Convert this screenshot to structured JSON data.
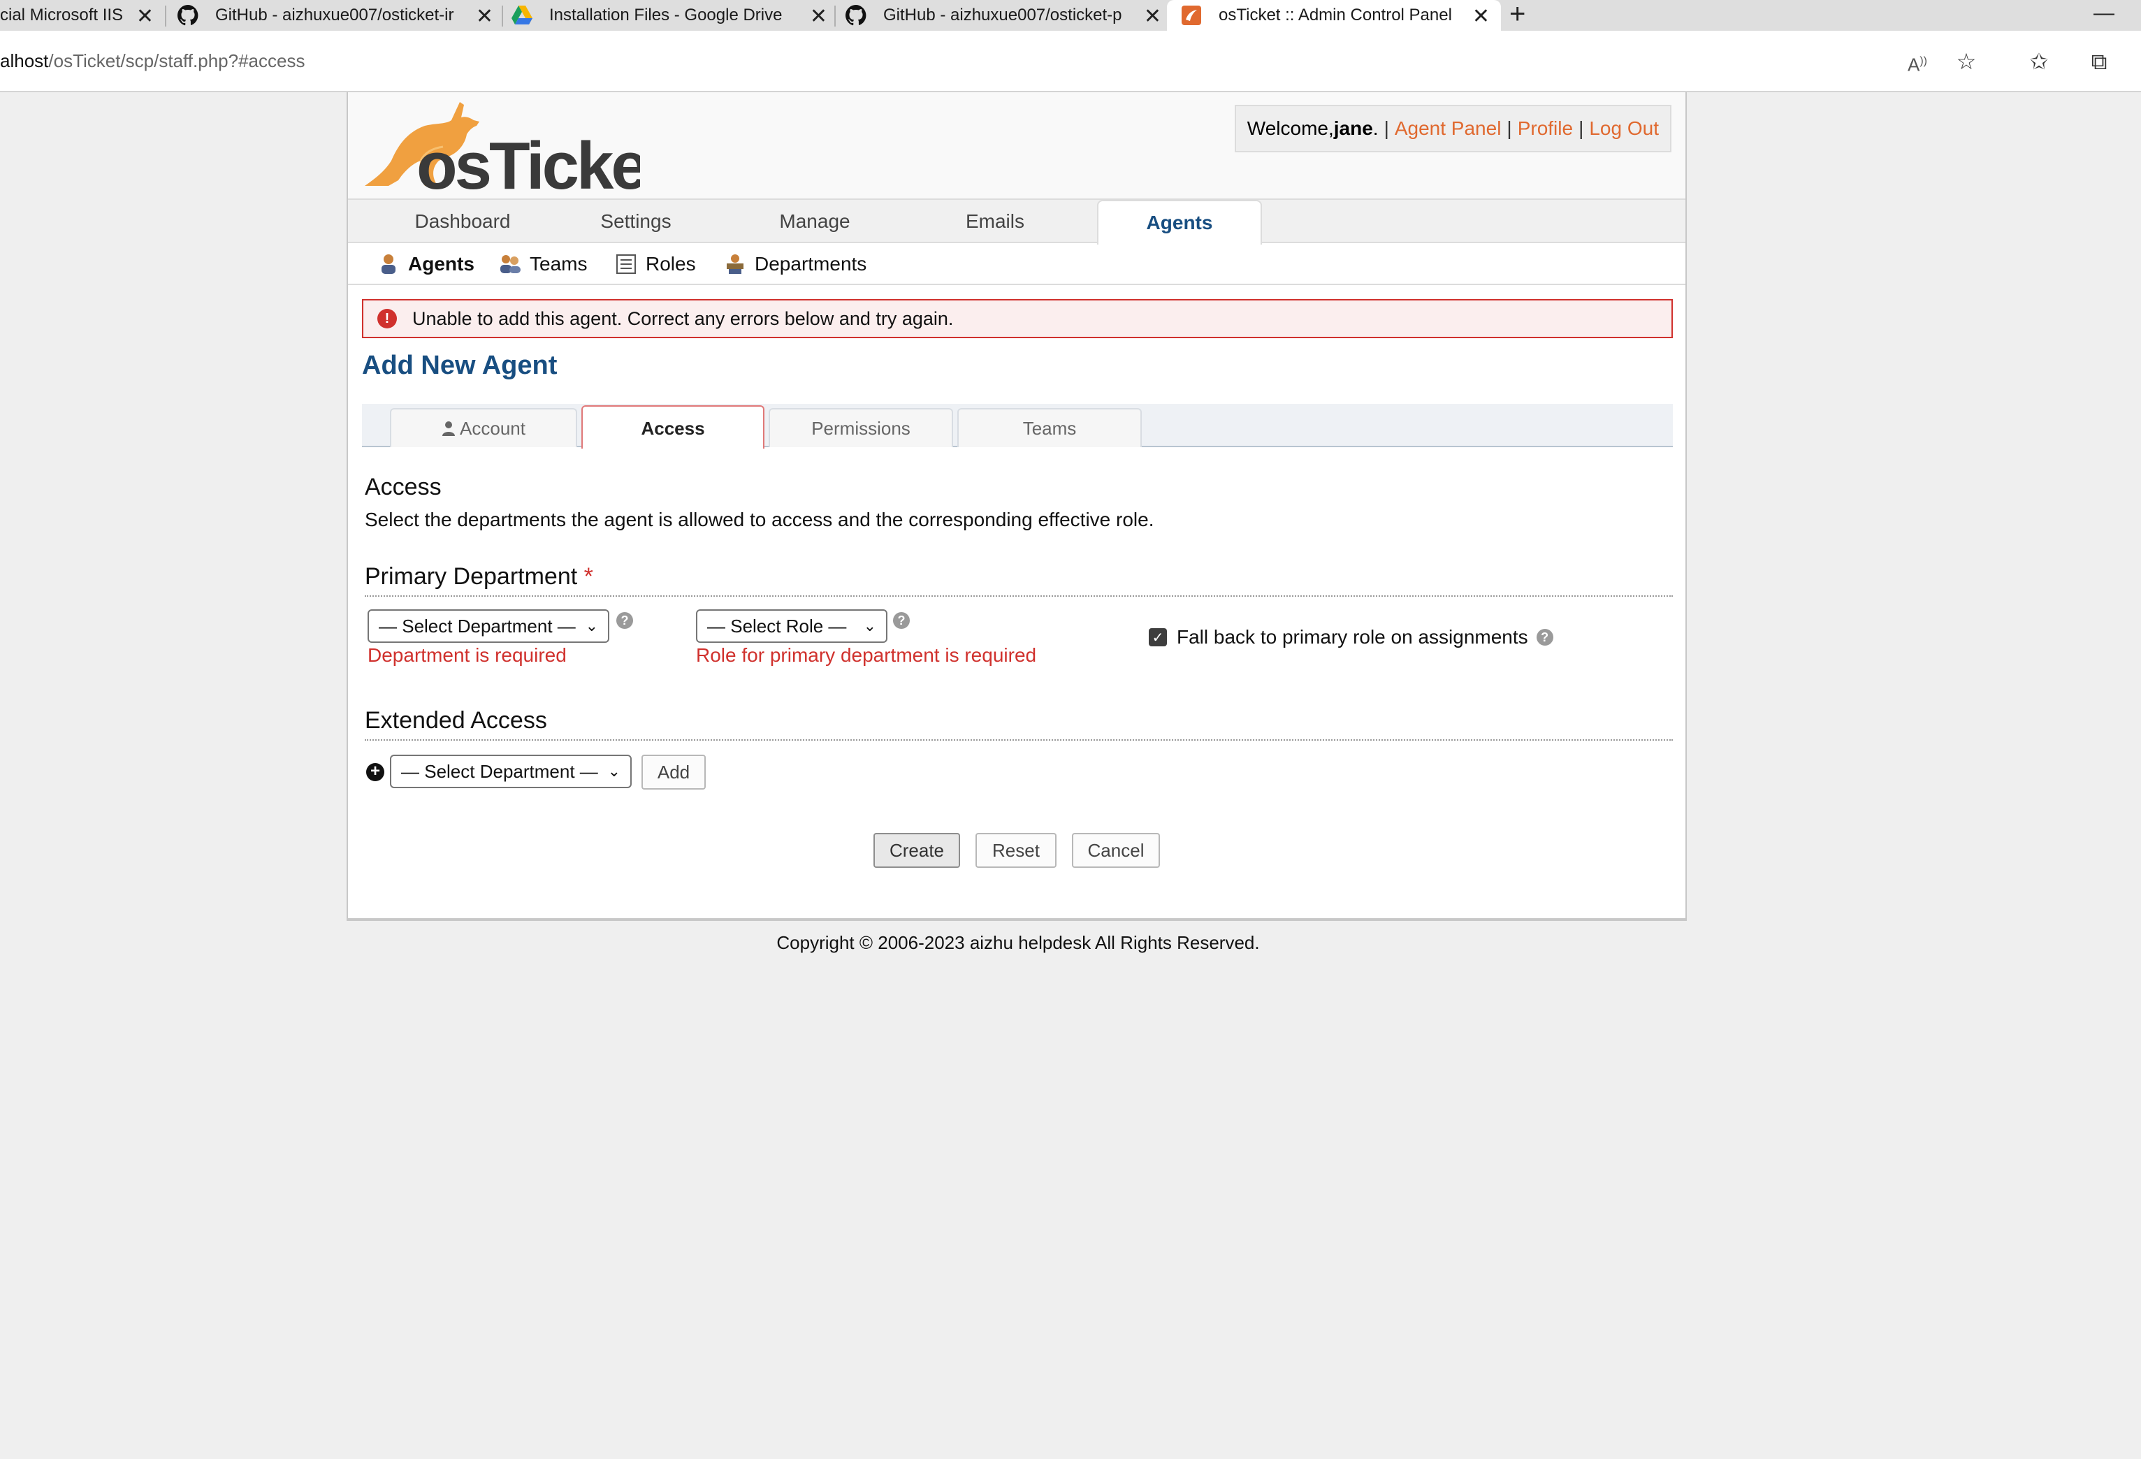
{
  "browser": {
    "tabs": [
      {
        "title": "cial Microsoft IIS",
        "icon": "generic-icon"
      },
      {
        "title": "GitHub - aizhuxue007/osticket-ir",
        "icon": "github-icon"
      },
      {
        "title": "Installation Files - Google Drive",
        "icon": "google-drive-icon"
      },
      {
        "title": "GitHub - aizhuxue007/osticket-p",
        "icon": "github-icon"
      },
      {
        "title": "osTicket :: Admin Control Panel",
        "icon": "osticket-icon",
        "active": true
      }
    ],
    "new_tab": "+",
    "minimize": "—",
    "close_glyph": "✕",
    "url_host": "alhost",
    "url_path": "/osTicket/scp/staff.php?#access"
  },
  "header": {
    "welcome_prefix": "Welcome, ",
    "username": "jane",
    "welcome_suffix": ".",
    "links": [
      "Agent Panel",
      "Profile",
      "Log Out"
    ],
    "sep": "|",
    "logo_text": "osTicket",
    "logo_color": "#f0a040"
  },
  "nav": {
    "tabs": [
      "Dashboard",
      "Settings",
      "Manage",
      "Emails",
      "Agents"
    ],
    "active": "Agents"
  },
  "subnav": {
    "items": [
      "Agents",
      "Teams",
      "Roles",
      "Departments"
    ],
    "active": "Agents"
  },
  "error": {
    "message": "Unable to add this agent. Correct any errors below and try again.",
    "icon_glyph": "!"
  },
  "page": {
    "title": "Add New Agent"
  },
  "form_tabs": {
    "items": [
      "Account",
      "Access",
      "Permissions",
      "Teams"
    ],
    "active": "Access"
  },
  "access": {
    "title": "Access",
    "description": "Select the departments the agent is allowed to access and the corresponding effective role."
  },
  "primary": {
    "title": "Primary Department",
    "required_mark": "*",
    "department_select": "— Select Department —",
    "role_select": "— Select Role —",
    "department_error": "Department is required",
    "role_error": "Role for primary department is required",
    "fallback_label": "Fall back to primary role on assignments",
    "fallback_checked": true,
    "help_glyph": "?"
  },
  "extended": {
    "title": "Extended Access",
    "department_select": "— Select Department —",
    "add_label": "Add"
  },
  "actions": {
    "create": "Create",
    "reset": "Reset",
    "cancel": "Cancel"
  },
  "footer": {
    "copyright": "Copyright © 2006-2023 aizhu helpdesk All Rights Reserved."
  },
  "colors": {
    "accent_blue": "#184e81",
    "link_orange": "#e0692f",
    "error_red": "#d0312d"
  }
}
